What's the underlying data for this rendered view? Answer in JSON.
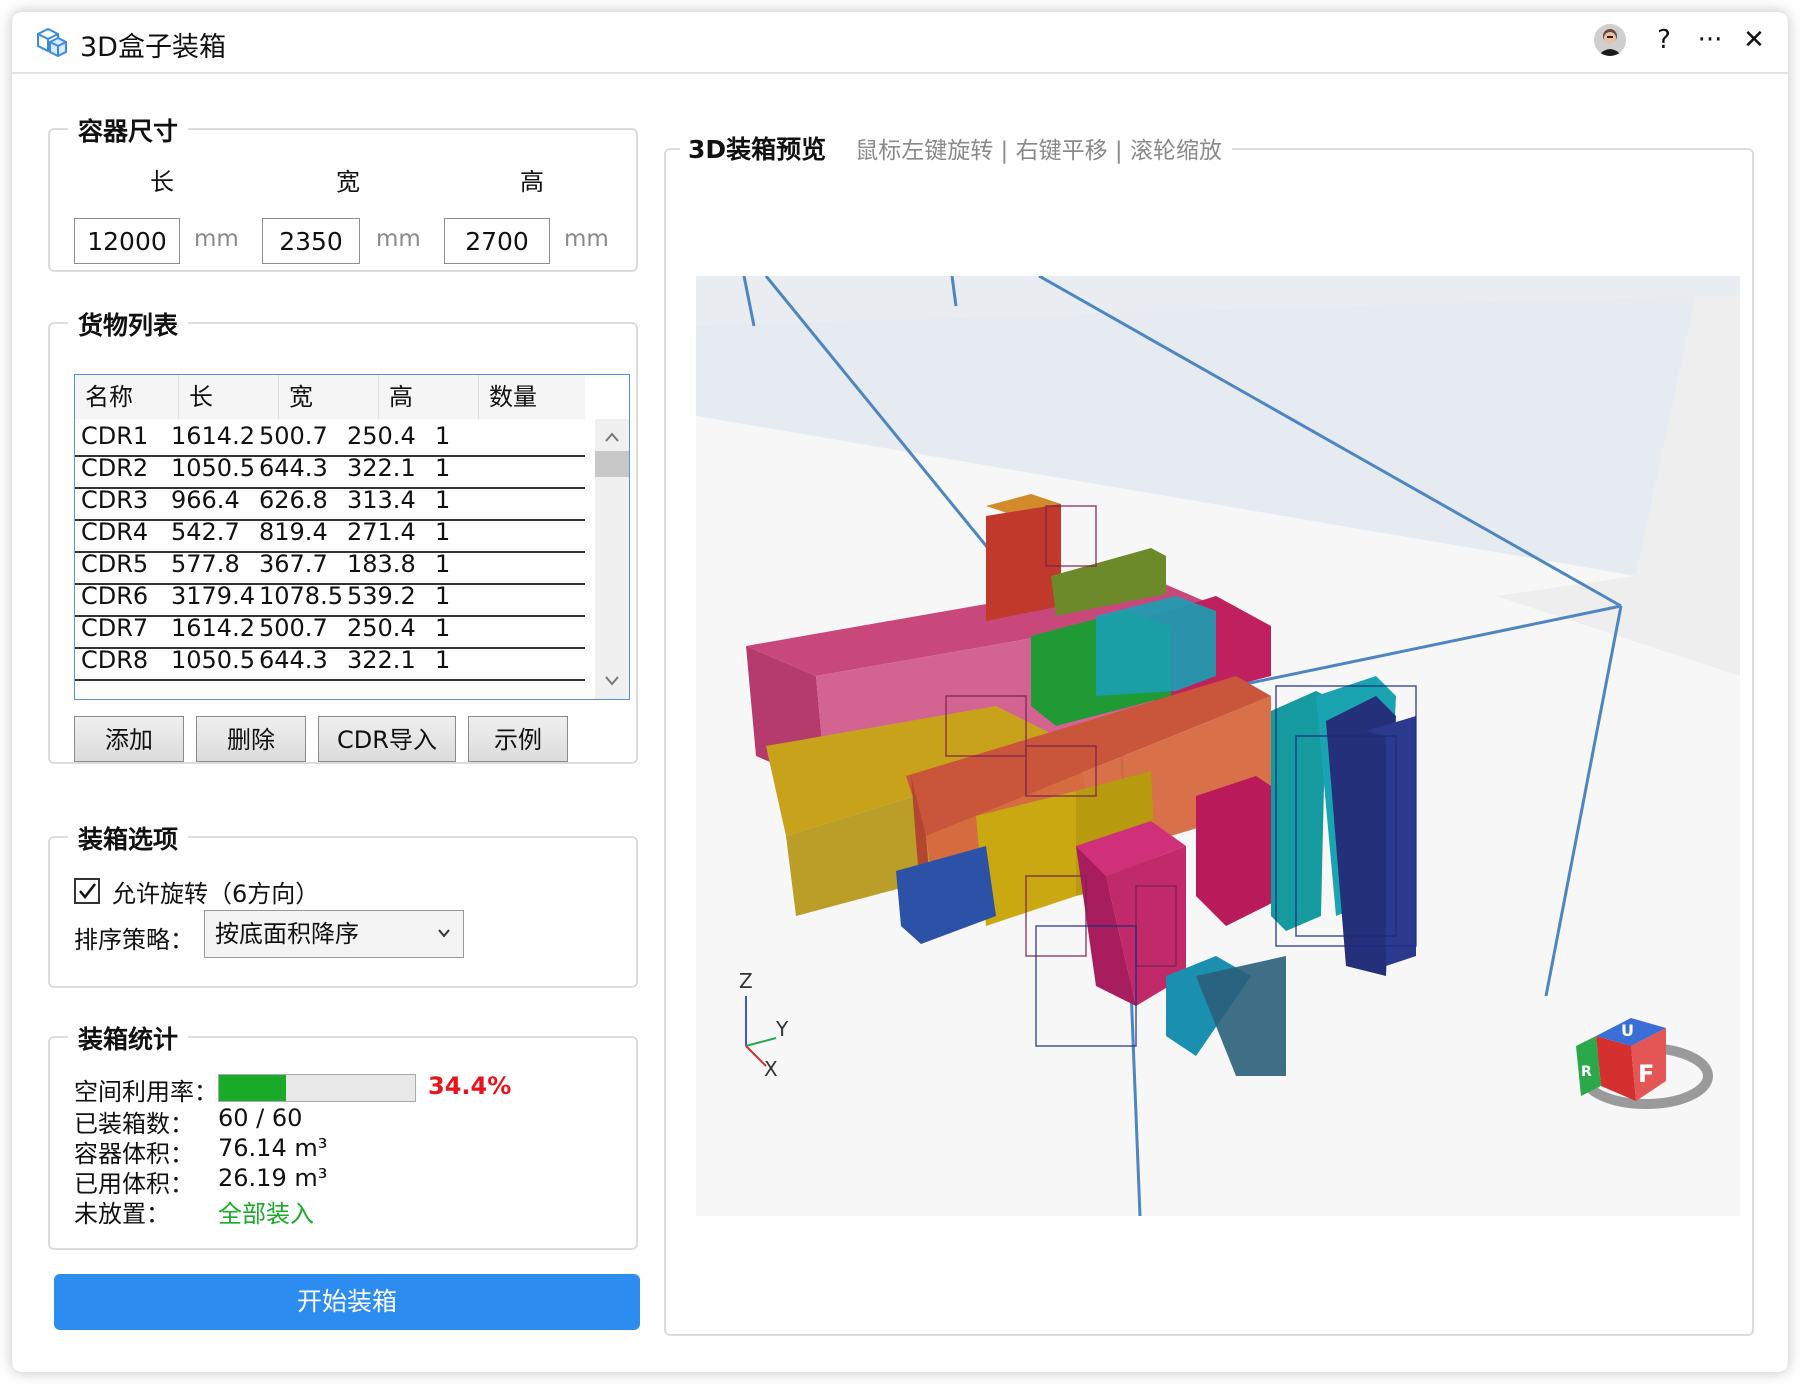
{
  "app": {
    "title": "3D盒子装箱"
  },
  "titlebar": {
    "help": "?",
    "more": "···",
    "close": "✕"
  },
  "container": {
    "title": "容器尺寸",
    "length_label": "长",
    "width_label": "宽",
    "height_label": "高",
    "length": "12000",
    "width": "2350",
    "height": "2700",
    "unit": "mm"
  },
  "cargo": {
    "title": "货物列表",
    "columns": [
      "名称",
      "长",
      "宽",
      "高",
      "数量"
    ],
    "rows": [
      [
        "CDR1",
        "1614.2",
        "500.7",
        "250.4",
        "1"
      ],
      [
        "CDR2",
        "1050.5",
        "644.3",
        "322.1",
        "1"
      ],
      [
        "CDR3",
        "966.4",
        "626.8",
        "313.4",
        "1"
      ],
      [
        "CDR4",
        "542.7",
        "819.4",
        "271.4",
        "1"
      ],
      [
        "CDR5",
        "577.8",
        "367.7",
        "183.8",
        "1"
      ],
      [
        "CDR6",
        "3179.4",
        "1078.5",
        "539.2",
        "1"
      ],
      [
        "CDR7",
        "1614.2",
        "500.7",
        "250.4",
        "1"
      ],
      [
        "CDR8",
        "1050.5",
        "644.3",
        "322.1",
        "1"
      ]
    ],
    "buttons": {
      "add": "添加",
      "delete": "删除",
      "import": "CDR导入",
      "example": "示例"
    }
  },
  "options": {
    "title": "装箱选项",
    "allow_rotation": "允许旋转（6方向）",
    "allow_rotation_checked": true,
    "sort_label": "排序策略：",
    "sort_value": "按底面积降序"
  },
  "stats": {
    "title": "装箱统计",
    "utilization_label": "空间利用率：",
    "utilization_value": "34.4%",
    "utilization_fraction": 0.344,
    "packed_label": "已装箱数：",
    "packed_value": "60 / 60",
    "container_volume_label": "容器体积：",
    "container_volume_value": "76.14 m³",
    "used_volume_label": "已用体积：",
    "used_volume_value": "26.19 m³",
    "unplaced_label": "未放置：",
    "unplaced_value": "全部装入"
  },
  "start_button": "开始装箱",
  "preview": {
    "title": "3D装箱预览",
    "hint": "鼠标左键旋转 | 右键平移 | 滚轮缩放",
    "axes": {
      "z": "Z",
      "y": "Y",
      "x": "X"
    },
    "cube_faces": {
      "top": "U",
      "front": "F",
      "side": "R"
    }
  },
  "colors": {
    "accent": "#2d8cf0",
    "progress": "#1aaa2a",
    "danger": "#e8141c",
    "success": "#1aaa2a"
  }
}
